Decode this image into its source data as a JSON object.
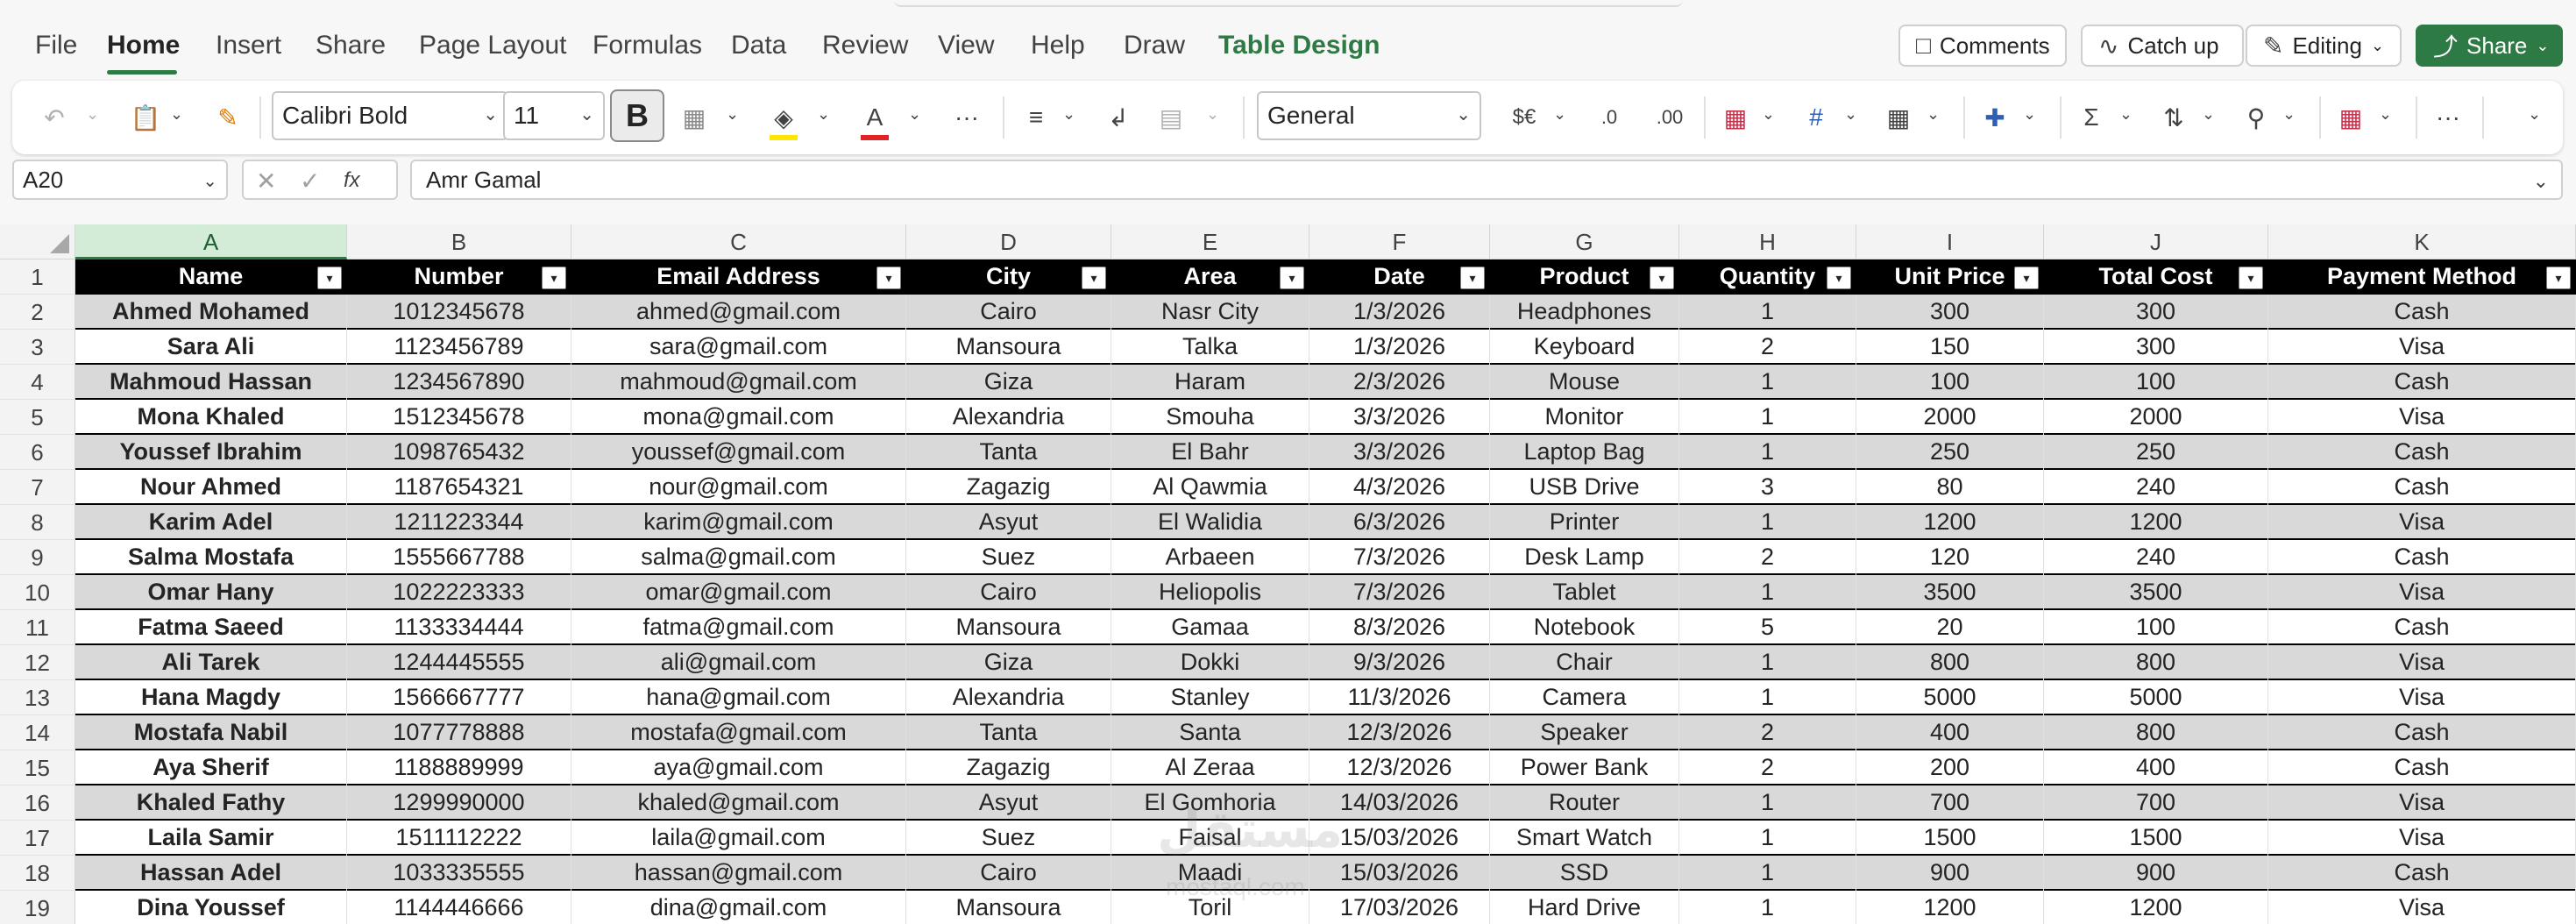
{
  "menu": {
    "items": [
      "File",
      "Home",
      "Insert",
      "Share",
      "Page Layout",
      "Formulas",
      "Data",
      "Review",
      "View",
      "Help",
      "Draw",
      "Table Design"
    ],
    "active": "Home"
  },
  "top_buttons": {
    "comments": "Comments",
    "catch_up": "Catch up",
    "editing": "Editing",
    "share": "Share"
  },
  "ribbon": {
    "font_name": "Calibri Bold",
    "font_size": "11",
    "bold": "B",
    "number_format": "General",
    "currency_symbol": "$€",
    "decrease_decimal": ".0",
    "increase_decimal": ".00",
    "sum_symbol": "Σ",
    "more": "···",
    "colors": {
      "highlight": "#ffe600",
      "font_color": "#e02424",
      "accent": "#2e7a44"
    }
  },
  "formula_bar": {
    "cell_ref": "A20",
    "fx": "fx",
    "value": "Amr Gamal"
  },
  "grid": {
    "columns": [
      "A",
      "B",
      "C",
      "D",
      "E",
      "F",
      "G",
      "H",
      "I",
      "J",
      "K"
    ],
    "selected_column": "A",
    "row_numbers": [
      "1",
      "2",
      "3",
      "4",
      "5",
      "6",
      "7",
      "8",
      "9",
      "10",
      "11",
      "12",
      "13",
      "14",
      "15",
      "16",
      "17",
      "18",
      "19"
    ],
    "headers": [
      "Name",
      "Number",
      "Email Address",
      "City",
      "Area",
      "Date",
      "Product",
      "Quantity",
      "Unit Price",
      "Total Cost",
      "Payment Method"
    ],
    "rows": [
      [
        "Ahmed Mohamed",
        "1012345678",
        "ahmed@gmail.com",
        "Cairo",
        "Nasr City",
        "1/3/2026",
        "Headphones",
        "1",
        "300",
        "300",
        "Cash"
      ],
      [
        "Sara Ali",
        "1123456789",
        "sara@gmail.com",
        "Mansoura",
        "Talka",
        "1/3/2026",
        "Keyboard",
        "2",
        "150",
        "300",
        "Visa"
      ],
      [
        "Mahmoud Hassan",
        "1234567890",
        "mahmoud@gmail.com",
        "Giza",
        "Haram",
        "2/3/2026",
        "Mouse",
        "1",
        "100",
        "100",
        "Cash"
      ],
      [
        "Mona Khaled",
        "1512345678",
        "mona@gmail.com",
        "Alexandria",
        "Smouha",
        "3/3/2026",
        "Monitor",
        "1",
        "2000",
        "2000",
        "Visa"
      ],
      [
        "Youssef Ibrahim",
        "1098765432",
        "youssef@gmail.com",
        "Tanta",
        "El Bahr",
        "3/3/2026",
        "Laptop Bag",
        "1",
        "250",
        "250",
        "Cash"
      ],
      [
        "Nour Ahmed",
        "1187654321",
        "nour@gmail.com",
        "Zagazig",
        "Al Qawmia",
        "4/3/2026",
        "USB Drive",
        "3",
        "80",
        "240",
        "Cash"
      ],
      [
        "Karim Adel",
        "1211223344",
        "karim@gmail.com",
        "Asyut",
        "El Walidia",
        "6/3/2026",
        "Printer",
        "1",
        "1200",
        "1200",
        "Visa"
      ],
      [
        "Salma Mostafa",
        "1555667788",
        "salma@gmail.com",
        "Suez",
        "Arbaeen",
        "7/3/2026",
        "Desk Lamp",
        "2",
        "120",
        "240",
        "Cash"
      ],
      [
        "Omar Hany",
        "1022223333",
        "omar@gmail.com",
        "Cairo",
        "Heliopolis",
        "7/3/2026",
        "Tablet",
        "1",
        "3500",
        "3500",
        "Visa"
      ],
      [
        "Fatma Saeed",
        "1133334444",
        "fatma@gmail.com",
        "Mansoura",
        "Gamaa",
        "8/3/2026",
        "Notebook",
        "5",
        "20",
        "100",
        "Cash"
      ],
      [
        "Ali Tarek",
        "1244445555",
        "ali@gmail.com",
        "Giza",
        "Dokki",
        "9/3/2026",
        "Chair",
        "1",
        "800",
        "800",
        "Visa"
      ],
      [
        "Hana Magdy",
        "1566667777",
        "hana@gmail.com",
        "Alexandria",
        "Stanley",
        "11/3/2026",
        "Camera",
        "1",
        "5000",
        "5000",
        "Visa"
      ],
      [
        "Mostafa Nabil",
        "1077778888",
        "mostafa@gmail.com",
        "Tanta",
        "Santa",
        "12/3/2026",
        "Speaker",
        "2",
        "400",
        "800",
        "Cash"
      ],
      [
        "Aya Sherif",
        "1188889999",
        "aya@gmail.com",
        "Zagazig",
        "Al Zeraa",
        "12/3/2026",
        "Power Bank",
        "2",
        "200",
        "400",
        "Cash"
      ],
      [
        "Khaled Fathy",
        "1299990000",
        "khaled@gmail.com",
        "Asyut",
        "El Gomhoria",
        "14/03/2026",
        "Router",
        "1",
        "700",
        "700",
        "Visa"
      ],
      [
        "Laila Samir",
        "1511112222",
        "laila@gmail.com",
        "Suez",
        "Faisal",
        "15/03/2026",
        "Smart Watch",
        "1",
        "1500",
        "1500",
        "Visa"
      ],
      [
        "Hassan Adel",
        "1033335555",
        "hassan@gmail.com",
        "Cairo",
        "Maadi",
        "15/03/2026",
        "SSD",
        "1",
        "900",
        "900",
        "Cash"
      ],
      [
        "Dina Youssef",
        "1144446666",
        "dina@gmail.com",
        "Mansoura",
        "Toril",
        "17/03/2026",
        "Hard Drive",
        "1",
        "1200",
        "1200",
        "Visa"
      ]
    ]
  }
}
